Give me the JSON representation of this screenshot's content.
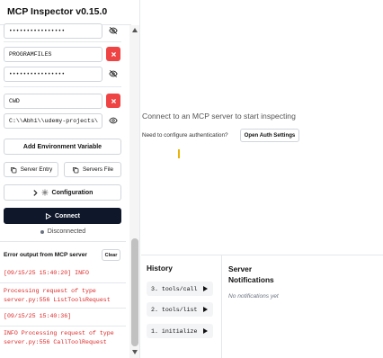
{
  "app": {
    "title": "MCP Inspector v0.15.0"
  },
  "sidebar": {
    "env_vars": [
      {
        "key": "",
        "value": "••••••••••••••••"
      },
      {
        "key": "PROGRAMFILES",
        "value": "••••••••••••••••"
      },
      {
        "key": "CWD",
        "value": "C:\\\\Abhi\\\\udemy-projects\\"
      }
    ],
    "add_env_label": "Add Environment Variable",
    "server_entry_label": "Server Entry",
    "servers_file_label": "Servers File",
    "configuration_label": "Configuration",
    "connect_label": "Connect",
    "status_text": "Disconnected",
    "status_color": "#6b7280",
    "error_title": "Error output from MCP server",
    "clear_label": "Clear",
    "logs": [
      {
        "line1": "[09/15/25 15:40:20] INFO",
        "line2": ""
      },
      {
        "line1": "Processing request of type",
        "line2": "server.py:556 ListToolsRequest"
      },
      {
        "line1": "[09/15/25 15:40:36]",
        "line2": ""
      },
      {
        "line1": "INFO Processing request of type",
        "line2": "server.py:556 CallToolRequest"
      }
    ],
    "log_color": "#dc2626"
  },
  "main": {
    "connect_message": "Connect to an MCP server to start inspecting",
    "auth_question": "Need to configure authentication?",
    "auth_button_label": "Open Auth Settings"
  },
  "history": {
    "title": "History",
    "items": [
      "3. tools/call",
      "2. tools/list",
      "1. initialize"
    ]
  },
  "notifications": {
    "title": "Server Notifications",
    "empty_text": "No notifications yet"
  },
  "colors": {
    "primary": "#0f172a",
    "danger": "#ef4444",
    "accent": "#eab308"
  }
}
